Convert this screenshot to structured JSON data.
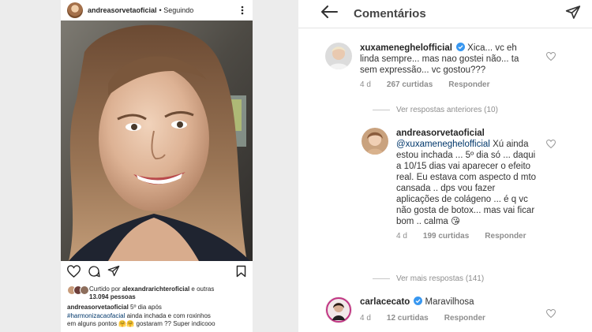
{
  "post": {
    "username": "andreasorvetaoficial",
    "follow_status": "• Seguindo",
    "liked_by_prefix": "Curtido por",
    "liked_by_user": "alexandrarichteroficial",
    "liked_by_suffix": "e outras",
    "liked_by_count": "13.094 pessoas",
    "caption_user": "andreasorvetaoficial",
    "caption_lines": [
      "5º dia após",
      "#harmonizacaofacial",
      "ainda inchada e com roxinhos",
      "em alguns pontos 🤗🤗 gostaram ?? Super indicooo"
    ],
    "icons": [
      "more-vertical-icon",
      "heart-icon",
      "comment-icon",
      "share-icon",
      "bookmark-icon"
    ]
  },
  "comments_panel": {
    "title": "Comentários",
    "back_icon": "arrow-left-icon",
    "send_icon": "send-icon",
    "comments": [
      {
        "user": "xuxameneghelofficial",
        "verified": true,
        "text": "Xica... vc eh linda sempre... mas nao gostei não... ta sem expressão... vc gostou???",
        "age": "4 d",
        "likes": "267 curtidas",
        "reply": "Responder"
      },
      {
        "user": "andreasorvetaoficial",
        "mention": "@xuxameneghelofficial",
        "text": "Xú ainda estou inchada ... 5º dia só ... daqui a 10/15 dias vai aparecer o efeito real. Eu estava com aspecto d mto cansada .. dps vou fazer aplicações de colágeno ... é q vc não gosta de botox... mas vai ficar bom .. calma 😘",
        "age": "4 d",
        "likes": "199 curtidas",
        "reply": "Responder"
      },
      {
        "user": "carlacecato",
        "verified": true,
        "text": "Maravilhosa",
        "age": "4 d",
        "likes": "12 curtidas",
        "reply": "Responder"
      }
    ],
    "view_previous": "Ver respostas anteriores (10)",
    "view_more": "Ver mais respostas (141)"
  }
}
